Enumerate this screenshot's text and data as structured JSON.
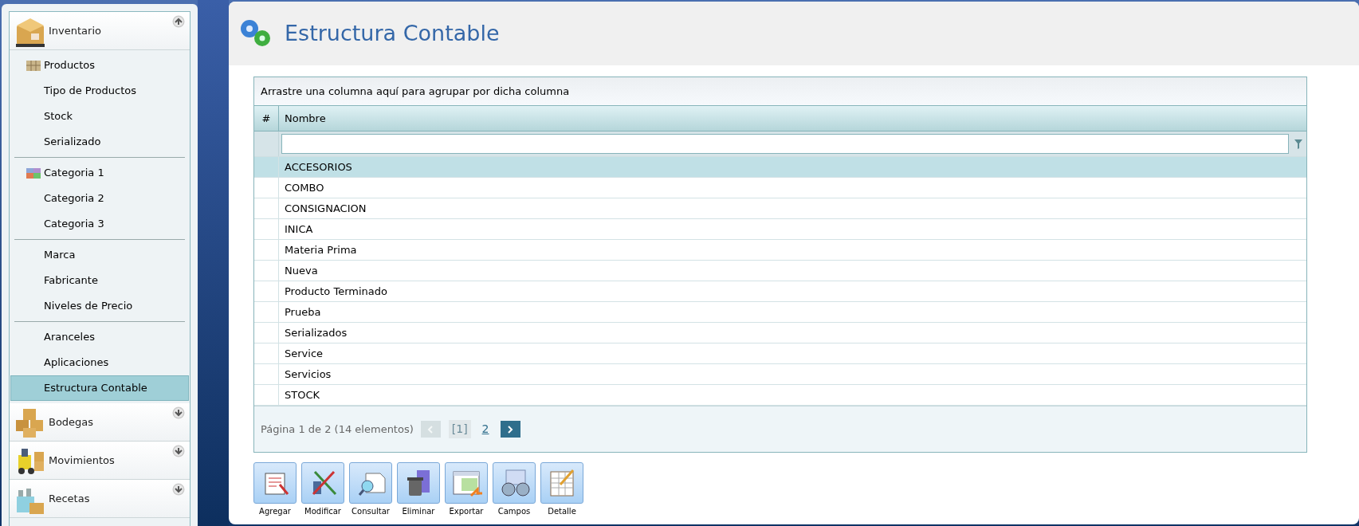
{
  "sidebar": {
    "sections": [
      {
        "label": "Inventario",
        "expanded": true,
        "groups": [
          [
            {
              "label": "Productos",
              "kind": "icon",
              "selected": false
            },
            {
              "label": "Tipo de Productos",
              "kind": "plain",
              "selected": false
            },
            {
              "label": "Stock",
              "kind": "plain",
              "selected": false
            },
            {
              "label": "Serializado",
              "kind": "plain",
              "selected": false
            }
          ],
          [
            {
              "label": "Categoria 1",
              "kind": "icon",
              "selected": false
            },
            {
              "label": "Categoria 2",
              "kind": "plain",
              "selected": false
            },
            {
              "label": "Categoria 3",
              "kind": "plain",
              "selected": false
            }
          ],
          [
            {
              "label": "Marca",
              "kind": "plain",
              "selected": false
            },
            {
              "label": "Fabricante",
              "kind": "plain",
              "selected": false
            },
            {
              "label": "Niveles de Precio",
              "kind": "plain",
              "selected": false
            }
          ],
          [
            {
              "label": "Aranceles",
              "kind": "plain",
              "selected": false
            },
            {
              "label": "Aplicaciones",
              "kind": "plain",
              "selected": false
            },
            {
              "label": "Estructura Contable",
              "kind": "plain",
              "selected": true
            }
          ]
        ]
      },
      {
        "label": "Bodegas",
        "expanded": false
      },
      {
        "label": "Movimientos",
        "expanded": false
      },
      {
        "label": "Recetas",
        "expanded": false
      }
    ]
  },
  "page": {
    "title": "Estructura Contable"
  },
  "grid": {
    "group_hint": "Arrastre una columna aquí para agrupar por dicha columna",
    "columns": [
      "#",
      "Nombre"
    ],
    "rows": [
      {
        "name": "ACCESORIOS",
        "selected": true
      },
      {
        "name": "COMBO",
        "selected": false
      },
      {
        "name": "CONSIGNACION",
        "selected": false
      },
      {
        "name": "INICA",
        "selected": false
      },
      {
        "name": "Materia Prima",
        "selected": false
      },
      {
        "name": "Nueva",
        "selected": false
      },
      {
        "name": "Producto Terminado",
        "selected": false
      },
      {
        "name": "Prueba",
        "selected": false
      },
      {
        "name": "Serializados",
        "selected": false
      },
      {
        "name": "Service",
        "selected": false
      },
      {
        "name": "Servicios",
        "selected": false
      },
      {
        "name": "STOCK",
        "selected": false
      }
    ],
    "pager": {
      "summary": "Página 1 de 2 (14 elementos)",
      "prev_disabled": true,
      "pages": [
        {
          "label": "[1]",
          "selected": true
        },
        {
          "label": "2",
          "selected": false
        }
      ],
      "next_disabled": false
    }
  },
  "toolbar": [
    {
      "label": "Agregar"
    },
    {
      "label": "Modificar"
    },
    {
      "label": "Consultar"
    },
    {
      "label": "Eliminar"
    },
    {
      "label": "Exportar"
    },
    {
      "label": "Campos"
    },
    {
      "label": "Detalle"
    }
  ]
}
